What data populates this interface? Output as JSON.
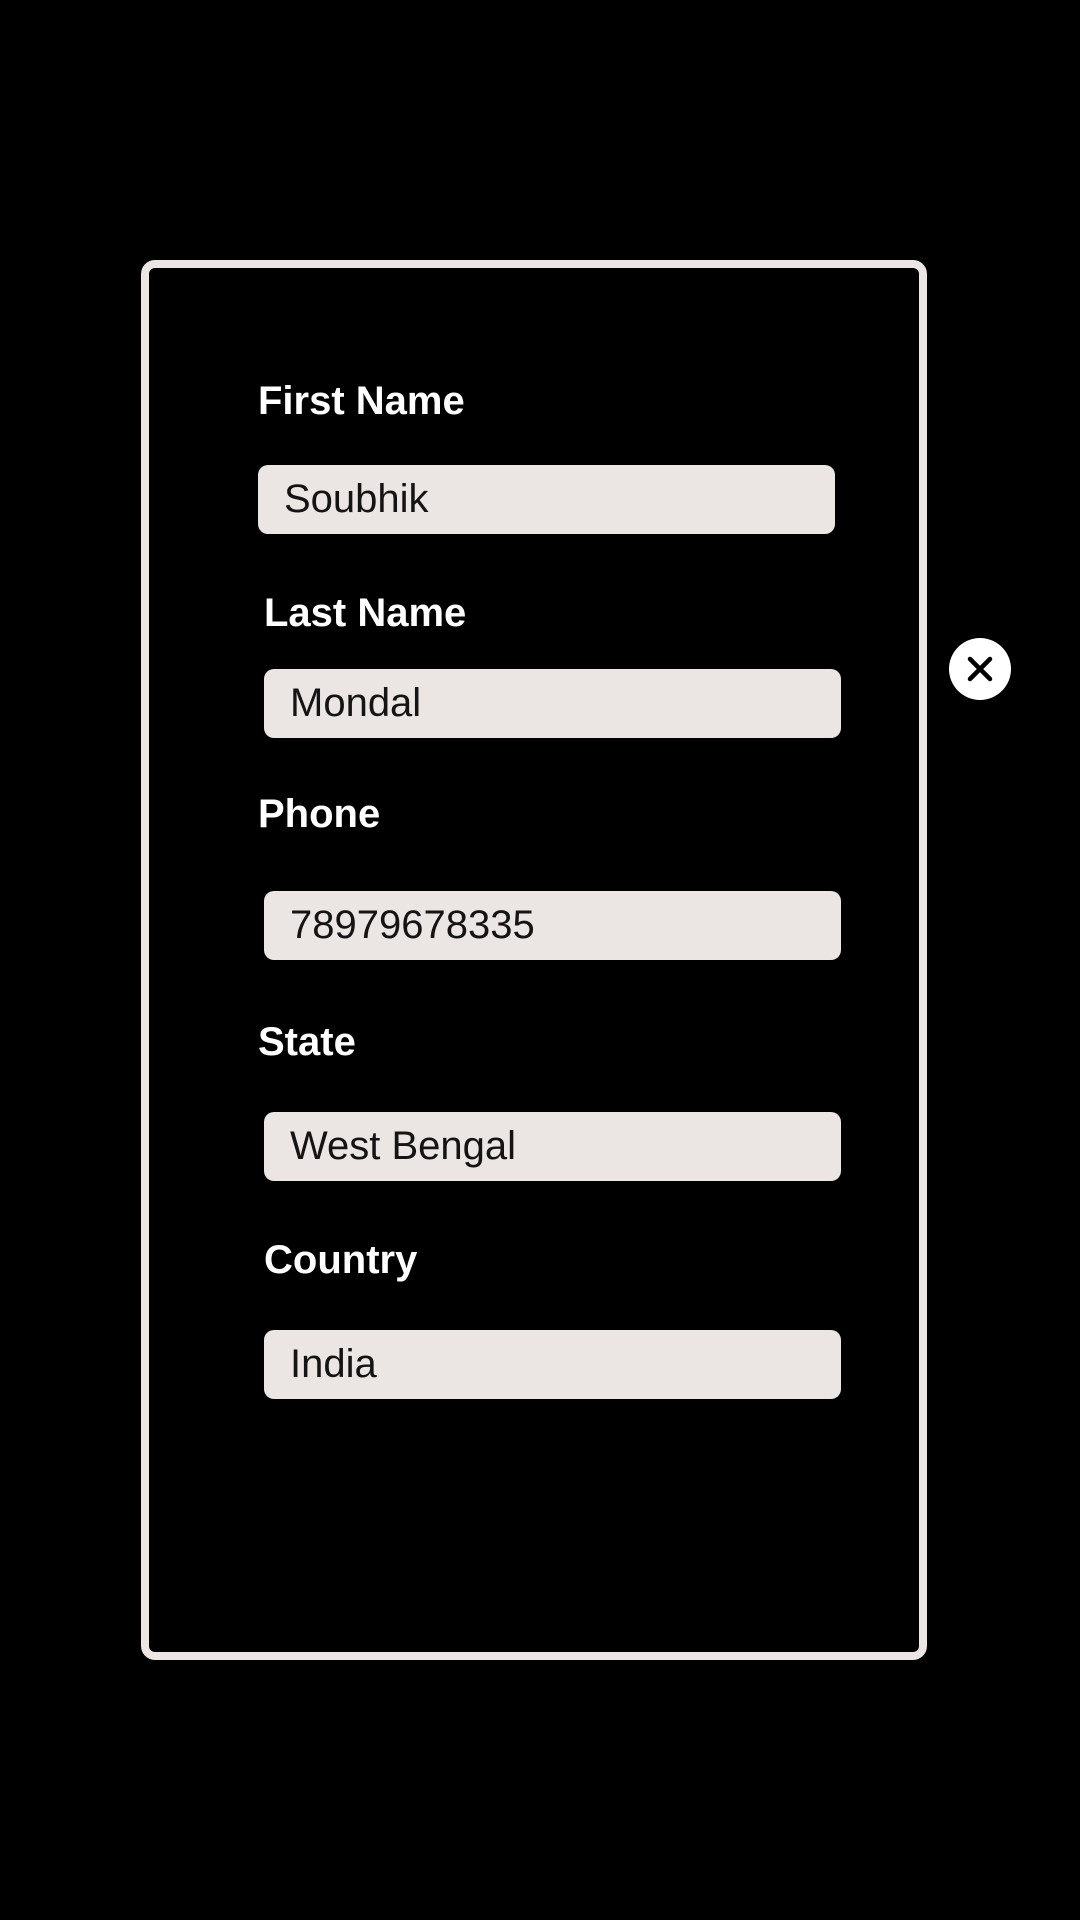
{
  "form": {
    "fields": [
      {
        "label": "First Name",
        "value": "Soubhik"
      },
      {
        "label": "Last Name",
        "value": "Mondal"
      },
      {
        "label": "Phone",
        "value": "78979678335"
      },
      {
        "label": "State",
        "value": "West Bengal"
      },
      {
        "label": "Country",
        "value": "India"
      }
    ]
  },
  "close_button": {
    "icon": "close-icon"
  },
  "colors": {
    "background": "#000000",
    "card_border": "#ebe6e3",
    "input_background": "#ebe6e3",
    "label_text": "#ffffff",
    "input_text": "#141414"
  }
}
